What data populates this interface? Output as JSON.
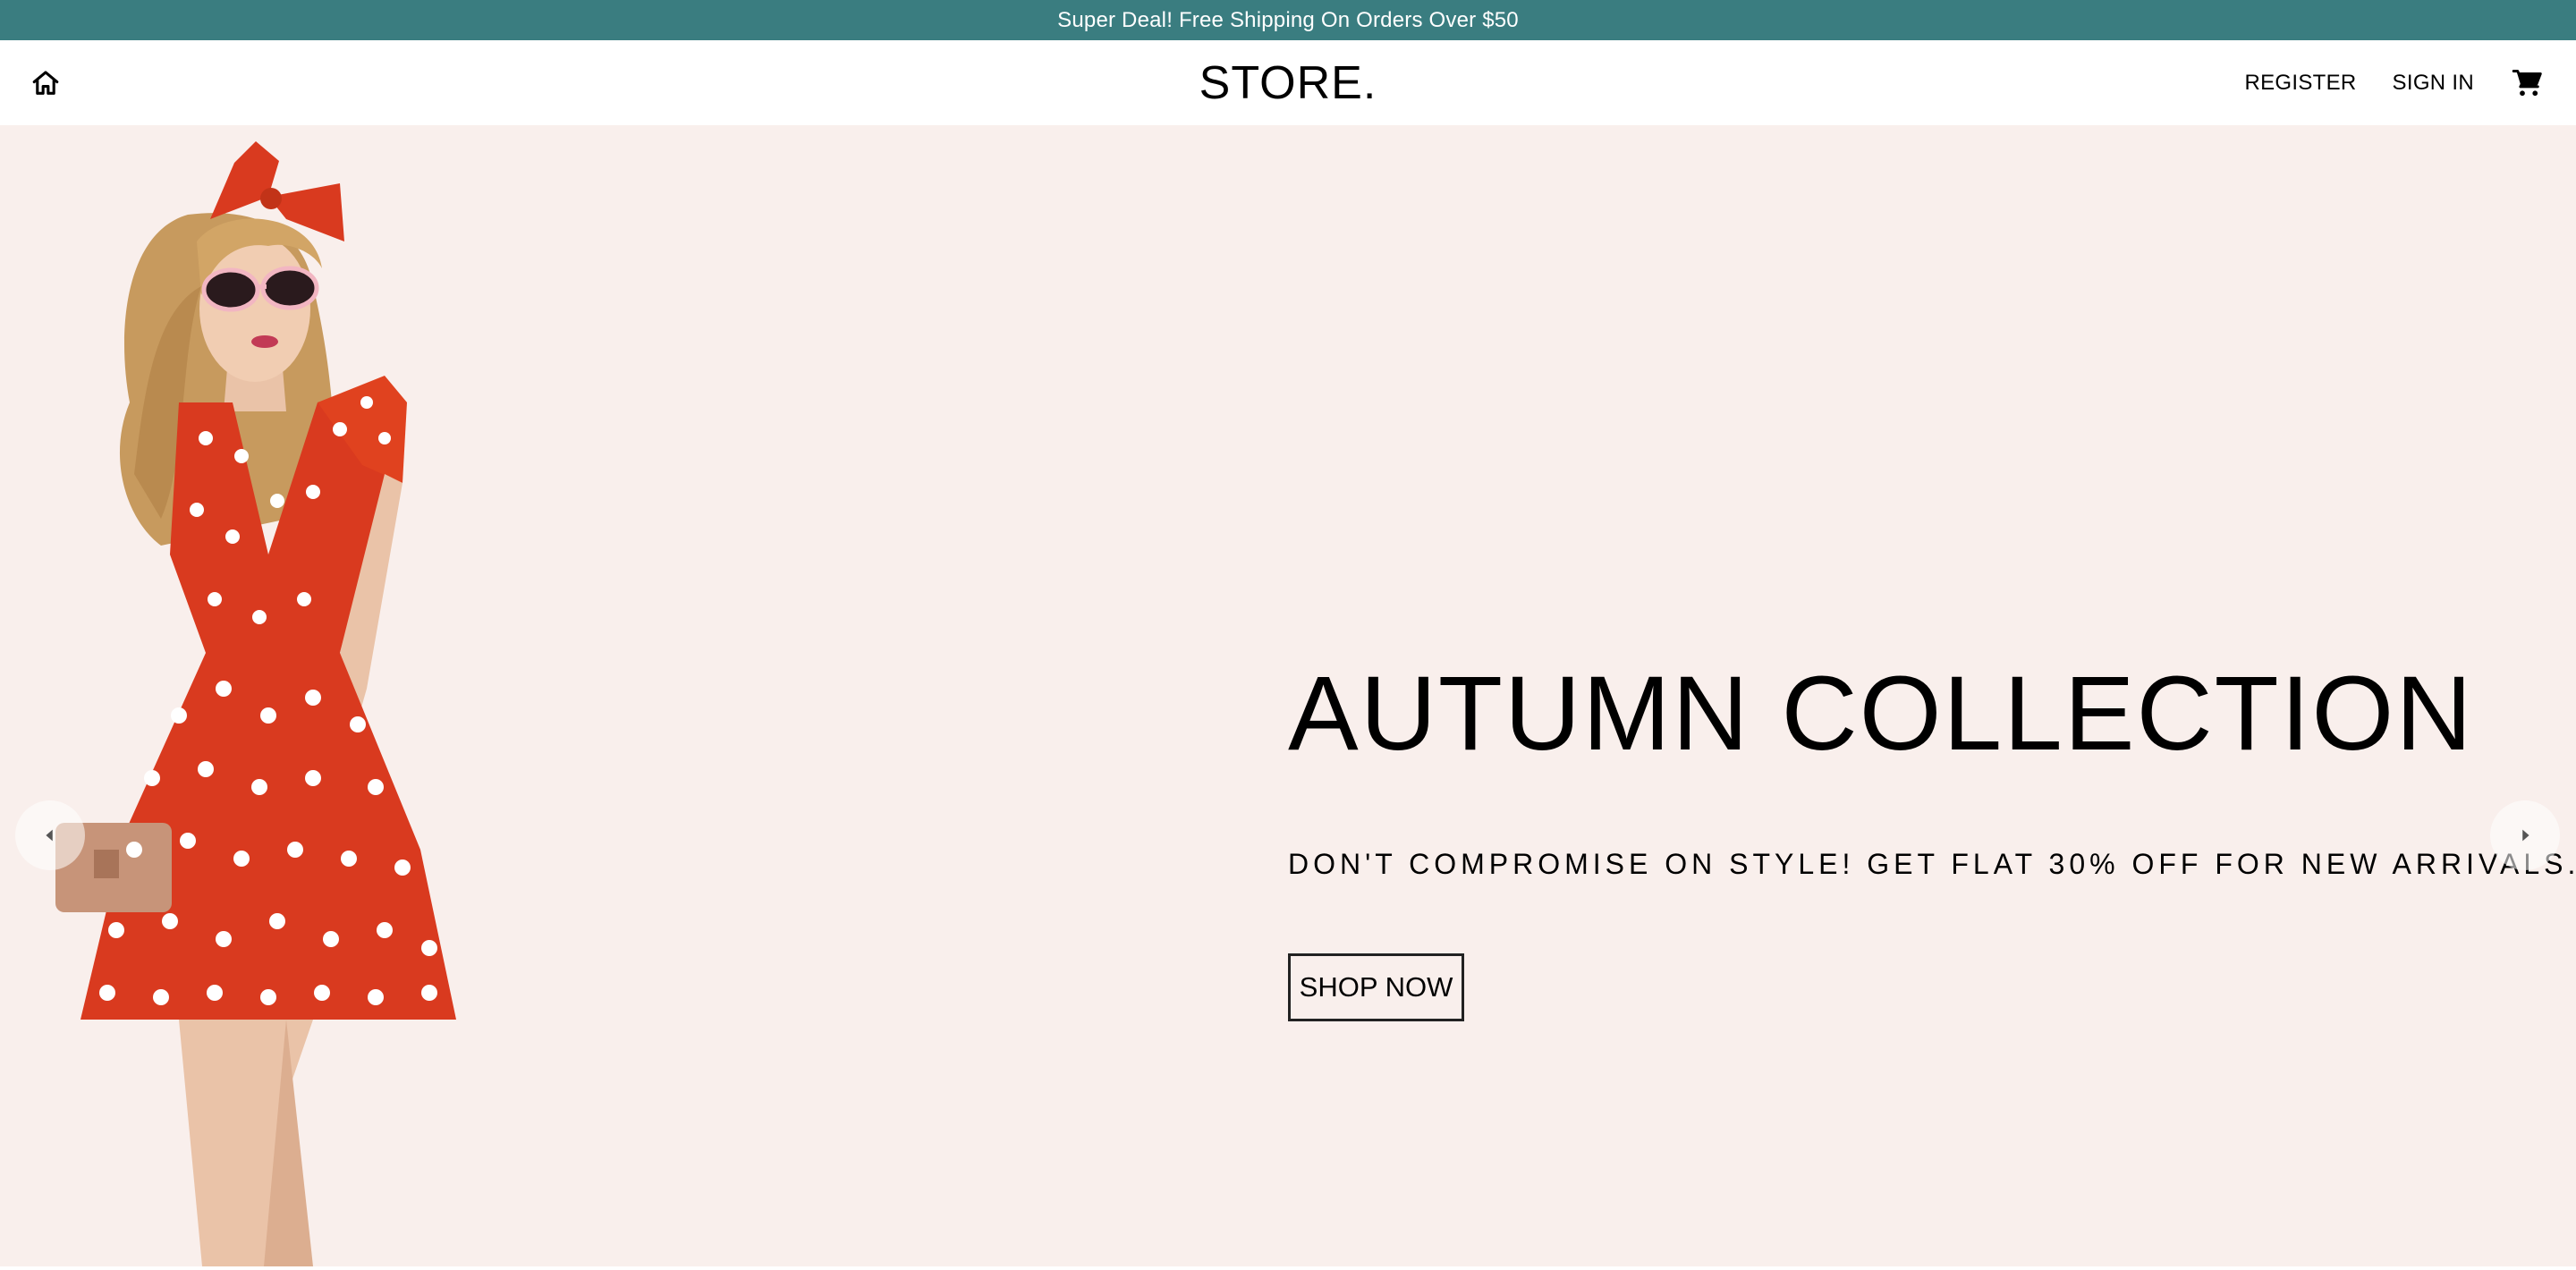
{
  "announcement": {
    "text": "Super Deal! Free Shipping On Orders Over $50"
  },
  "header": {
    "logo": "STORE.",
    "nav": {
      "register": "REGISTER",
      "signin": "SIGN IN"
    },
    "icons": {
      "home": "home-icon",
      "cart": "cart-icon"
    }
  },
  "hero": {
    "title": "AUTUMN COLLECTION",
    "subtitle": "DON'T COMPROMISE ON STYLE! GET FLAT 30% OFF FOR NEW ARRIVALS.",
    "cta": "SHOP NOW",
    "image": "model-in-red-polka-dot-dress",
    "arrows": {
      "prev": "arrow-left-icon",
      "next": "arrow-right-icon"
    }
  },
  "colors": {
    "announcement_bg": "#3a7d80",
    "hero_bg": "#f9efec",
    "dress": "#d93a1f",
    "text": "#000000"
  }
}
